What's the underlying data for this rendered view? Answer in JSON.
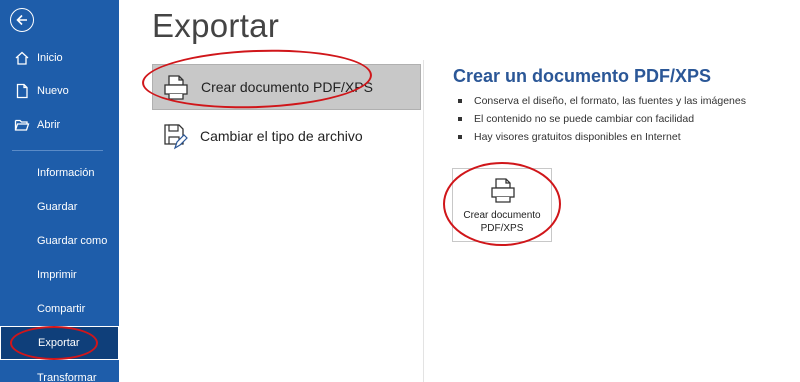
{
  "sidebar": {
    "items": [
      {
        "label": "Inicio"
      },
      {
        "label": "Nuevo"
      },
      {
        "label": "Abrir"
      },
      {
        "label": "Información"
      },
      {
        "label": "Guardar"
      },
      {
        "label": "Guardar como"
      },
      {
        "label": "Imprimir"
      },
      {
        "label": "Compartir"
      },
      {
        "label": "Exportar"
      },
      {
        "label": "Transformar"
      }
    ],
    "active": "Exportar",
    "colors": {
      "background": "#1e5daa",
      "active": "#0f3f7a"
    }
  },
  "main": {
    "title": "Exportar",
    "options": [
      {
        "label": "Crear documento PDF/XPS",
        "icon": "pdf-document-icon",
        "selected": true
      },
      {
        "label": "Cambiar el tipo de archivo",
        "icon": "change-file-type-icon",
        "selected": false
      }
    ]
  },
  "detail": {
    "title": "Crear un documento PDF/XPS",
    "bullets": [
      "Conserva el diseño, el formato, las fuentes y las imágenes",
      "El contenido no se puede cambiar con facilidad",
      "Hay visores gratuitos disponibles en Internet"
    ],
    "button": {
      "line1": "Crear documento",
      "line2": "PDF/XPS",
      "icon": "pdf-document-icon"
    }
  },
  "annotations": {
    "color": "#d0161a"
  }
}
